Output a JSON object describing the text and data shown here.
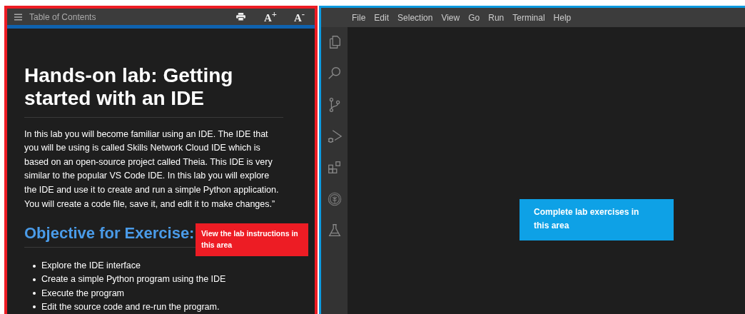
{
  "instructions_panel": {
    "header": {
      "title": "Table of Contents",
      "font_buttons": [
        "A$^{+}$",
        "A$^{-}$"
      ]
    },
    "title": "Hands-on lab: Getting started with an IDE",
    "intro": "In this lab you will become familiar using an IDE. The IDE that you will be using is called Skills Network Cloud IDE which is based on an open-source project called Theia. This IDE is very similar to the popular VS Code IDE. In this lab you will explore the IDE and use it to create and run a simple Python application. You will create a code file, save it, and edit it to make changes.”",
    "objective_heading": "Objective for Exercise:",
    "objectives": [
      "Explore the IDE interface",
      "Create a simple Python program using the IDE",
      "Execute the program",
      "Edit the source code and re-run the program."
    ],
    "callout": "View the lab instructions in this area"
  },
  "ide": {
    "menu": [
      "File",
      "Edit",
      "Selection",
      "View",
      "Go",
      "Run",
      "Terminal",
      "Help"
    ],
    "activity_bar": [
      {
        "kind": "files"
      },
      {
        "kind": "search"
      },
      {
        "kind": "source-control"
      },
      {
        "kind": "run-debug"
      },
      {
        "kind": "extensions"
      },
      {
        "kind": "skills-network"
      },
      {
        "kind": "lab"
      }
    ],
    "callout": "Complete lab exercises in this area"
  }
}
